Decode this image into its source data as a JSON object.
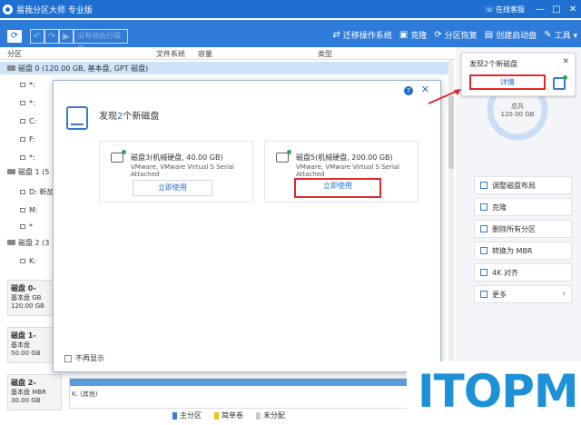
{
  "window": {
    "title": "易我分区大师 专业版",
    "online_label": "在线客服",
    "min_label": "—",
    "max_label": "□",
    "close_label": "✕"
  },
  "toolbar": {
    "pending_label": "没有待执行操作",
    "actions": [
      {
        "icon": "migrate-icon",
        "glyph": "⇄",
        "label": "迁移操作系统"
      },
      {
        "icon": "clone-icon",
        "glyph": "▣",
        "label": "克隆"
      },
      {
        "icon": "recover-icon",
        "glyph": "⟳",
        "label": "分区恢复"
      },
      {
        "icon": "bootdisk-icon",
        "glyph": "▤",
        "label": "创建启动盘"
      },
      {
        "icon": "tools-icon",
        "glyph": "✎",
        "label": "工具 ▾"
      }
    ]
  },
  "columns": [
    "分区",
    "文件系统",
    "容量",
    "类型"
  ],
  "rows": [
    {
      "label": "磁盘 0 (120.00 GB, 基本盘, GPT 磁盘)",
      "kind": "disk",
      "selected": true
    },
    {
      "label": "*:",
      "kind": "part"
    },
    {
      "label": "*:",
      "kind": "part"
    },
    {
      "label": "C:",
      "kind": "part"
    },
    {
      "label": "F:",
      "kind": "part"
    },
    {
      "label": "*:",
      "kind": "part"
    },
    {
      "label": "磁盘 1 (5",
      "kind": "disk"
    },
    {
      "label": "D: 新加",
      "kind": "part"
    },
    {
      "label": "M:",
      "kind": "part"
    },
    {
      "label": "*",
      "kind": "part"
    },
    {
      "label": "磁盘 2 (3",
      "kind": "disk"
    },
    {
      "label": "K:",
      "kind": "part"
    }
  ],
  "disk_cards": [
    {
      "name": "磁盘 0-",
      "type": "基本盘 GB",
      "size": "120.00 GB"
    },
    {
      "name": "磁盘 1-",
      "type": "基本盘",
      "size": "50.00 GB"
    },
    {
      "name": "磁盘 2-",
      "type": "基本盘 MBR",
      "size": "30.00 GB"
    }
  ],
  "disk2_bar_label": "K: (其他)",
  "legend": [
    {
      "label": "主分区",
      "color": "#3a78d4"
    },
    {
      "label": "简单卷",
      "color": "#e6c71a"
    },
    {
      "label": "未分配",
      "color": "#cccccc"
    }
  ],
  "notice": {
    "title": "发现2个新磁盘",
    "detail_button": "详情",
    "close": "✕"
  },
  "gauge": {
    "total_label": "总共",
    "total_value": "120.00 GB"
  },
  "right_actions": [
    {
      "label": "调整磁盘布局",
      "chev": false
    },
    {
      "label": "克隆",
      "chev": false
    },
    {
      "label": "删除所有分区",
      "chev": false
    },
    {
      "label": "转换为 MBR",
      "chev": false
    },
    {
      "label": "4K 对齐",
      "chev": false
    },
    {
      "label": "更多",
      "chev": true
    }
  ],
  "dialog": {
    "heading_prefix": "发现",
    "heading_num": "2",
    "heading_suffix": "个新磁盘",
    "help": "?",
    "close": "✕",
    "cards": [
      {
        "name": "磁盘3(机械硬盘, 40.00 GB)",
        "sub": "VMware,  VMware Virtual S Serial Attached",
        "use": "立即使用",
        "highlight": false
      },
      {
        "name": "磁盘5(机械硬盘, 200.00 GB)",
        "sub": "VMware,  VMware Virtual S Serial Attached",
        "use": "立即使用",
        "highlight": true
      }
    ],
    "noshow_label": "不再显示"
  },
  "watermark": "ITOPM",
  "colors": {
    "accent": "#1f6fd1",
    "highlight": "#e02a2a",
    "watermark": "#1d90d8"
  }
}
